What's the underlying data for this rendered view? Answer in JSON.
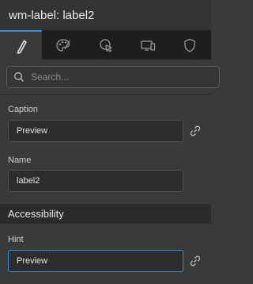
{
  "header": {
    "title": "wm-label: label2"
  },
  "tabs": [
    {
      "name": "properties",
      "icon": "pencil-icon",
      "active": true
    },
    {
      "name": "styles",
      "icon": "palette-icon",
      "active": false
    },
    {
      "name": "events",
      "icon": "cursor-click-icon",
      "active": false
    },
    {
      "name": "device",
      "icon": "devices-icon",
      "active": false
    },
    {
      "name": "security",
      "icon": "shield-icon",
      "active": false
    }
  ],
  "search": {
    "placeholder": "Search..."
  },
  "fields": {
    "caption": {
      "label": "Caption",
      "value": "Preview"
    },
    "name": {
      "label": "Name",
      "value": "label2"
    },
    "hint": {
      "label": "Hint",
      "value": "Preview"
    }
  },
  "sections": {
    "accessibility": "Accessibility"
  },
  "colors": {
    "accent": "#2f8fe0",
    "background": "#3a3a3a",
    "tabbar": "#1e1e1e"
  }
}
